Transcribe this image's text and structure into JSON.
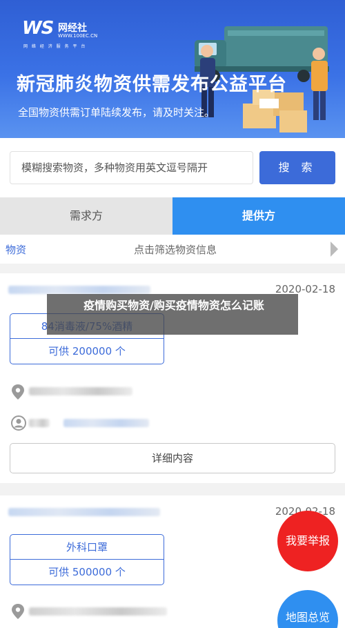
{
  "banner": {
    "logo_mark": "WS",
    "logo_name": "网经社",
    "logo_url": "WWW.100EC.CN",
    "logo_tagline": "网 络 经 济 服 务 平 台",
    "title": "新冠肺炎物资供需发布公益平台",
    "subtitle": "全国物资供需订单陆续发布，请及时关注。"
  },
  "search": {
    "placeholder": "模糊搜索物资，多种物资用英文逗号隔开",
    "button_label": "搜 索"
  },
  "tabs": [
    {
      "label": "需求方",
      "active": false
    },
    {
      "label": "提供方",
      "active": true
    }
  ],
  "filter": {
    "label": "物资",
    "hint": "点击筛选物资信息"
  },
  "listings": [
    {
      "date": "2020-02-18",
      "material": "84消毒液/75%酒精",
      "quantity": "可供 200000 个",
      "detail_label": "详细内容"
    },
    {
      "date": "2020-02-18",
      "material": "外科口罩",
      "quantity": "可供 500000 个"
    }
  ],
  "fab": {
    "report": "我要举报",
    "map": "地图总览"
  },
  "overlay_caption": "疫情购买物资/购买疫情物资怎么记账",
  "colors": {
    "primary": "#3c6bd9",
    "tab_active": "#2f8ff0",
    "report": "#ee2222"
  }
}
